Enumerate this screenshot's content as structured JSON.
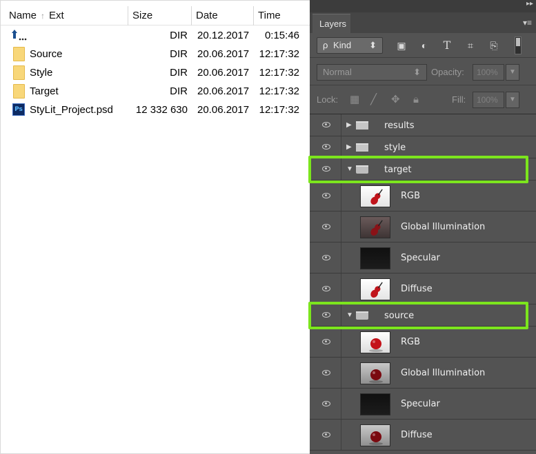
{
  "file_manager": {
    "columns": {
      "name": "Name",
      "sort_glyph": "↑",
      "ext": "Ext",
      "size": "Size",
      "date": "Date",
      "time": "Time"
    },
    "rows": [
      {
        "icon": "up-arrow-icon",
        "name": "..",
        "size": "DIR",
        "date": "20.12.2017",
        "time": "0:15:46"
      },
      {
        "icon": "folder-icon",
        "name": "Source",
        "size": "DIR",
        "date": "20.06.2017",
        "time": "12:17:32"
      },
      {
        "icon": "folder-icon",
        "name": "Style",
        "size": "DIR",
        "date": "20.06.2017",
        "time": "12:17:32"
      },
      {
        "icon": "folder-icon",
        "name": "Target",
        "size": "DIR",
        "date": "20.06.2017",
        "time": "12:17:32"
      },
      {
        "icon": "psd-file-icon",
        "name": "StyLit_Project.psd",
        "size": "12 332 630",
        "date": "20.06.2017",
        "time": "12:17:32"
      }
    ],
    "psd_badge": "Ps"
  },
  "layers_panel": {
    "tab_title": "Layers",
    "filter_kind": "Kind",
    "filter_search_glyph": "ρ",
    "blend_mode": "Normal",
    "opacity_label": "Opacity:",
    "opacity_value": "100%",
    "lock_label": "Lock:",
    "fill_label": "Fill:",
    "fill_value": "100%",
    "highlight_color": "#7ce51d",
    "panel_bg": "#535353",
    "layers": [
      {
        "type": "group",
        "name": "results",
        "expanded": false
      },
      {
        "type": "group",
        "name": "style",
        "expanded": false
      },
      {
        "type": "group",
        "name": "target",
        "expanded": true,
        "highlighted": true
      },
      {
        "type": "layer",
        "name": "RGB",
        "thumb": "violin"
      },
      {
        "type": "layer",
        "name": "Global Illumination",
        "thumb": "violin-dark"
      },
      {
        "type": "layer",
        "name": "Specular",
        "thumb": "black"
      },
      {
        "type": "layer",
        "name": "Diffuse",
        "thumb": "violin"
      },
      {
        "type": "group",
        "name": "source",
        "expanded": true,
        "highlighted": true
      },
      {
        "type": "layer",
        "name": "RGB",
        "thumb": "sphere"
      },
      {
        "type": "layer",
        "name": "Global Illumination",
        "thumb": "sphere-dark"
      },
      {
        "type": "layer",
        "name": "Specular",
        "thumb": "black"
      },
      {
        "type": "layer",
        "name": "Diffuse",
        "thumb": "sphere-dark"
      }
    ]
  }
}
